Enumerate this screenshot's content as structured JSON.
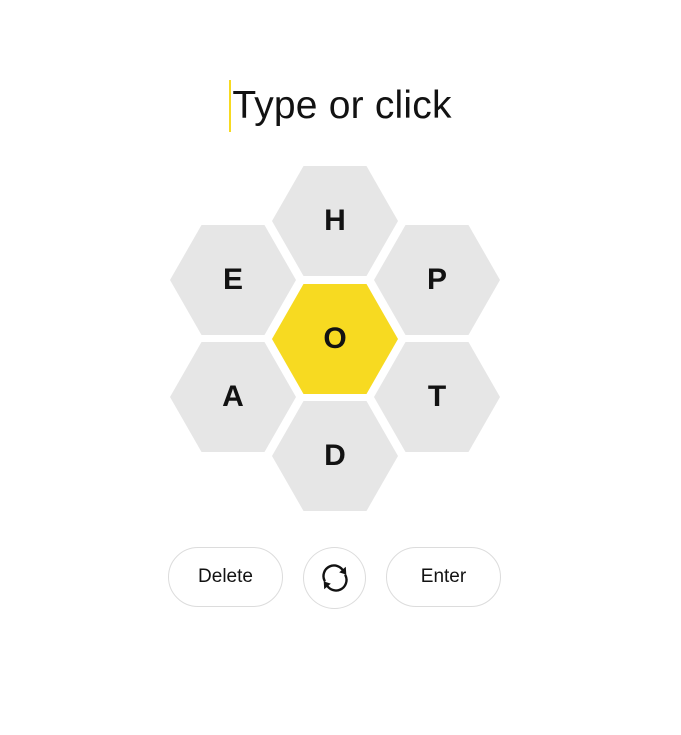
{
  "input": {
    "placeholder": "Type or click"
  },
  "hive": {
    "center_letter": "O",
    "outer_letters": {
      "top": "H",
      "upper_left": "E",
      "upper_right": "P",
      "lower_left": "A",
      "lower_right": "T",
      "bottom": "D"
    }
  },
  "controls": {
    "delete_label": "Delete",
    "enter_label": "Enter",
    "shuffle_icon": "shuffle-icon"
  },
  "colors": {
    "center_fill": "#f7da21",
    "outer_fill": "#e6e6e6",
    "text": "#121212",
    "caret": "#f7da21",
    "button_border": "#dcdcdc"
  }
}
